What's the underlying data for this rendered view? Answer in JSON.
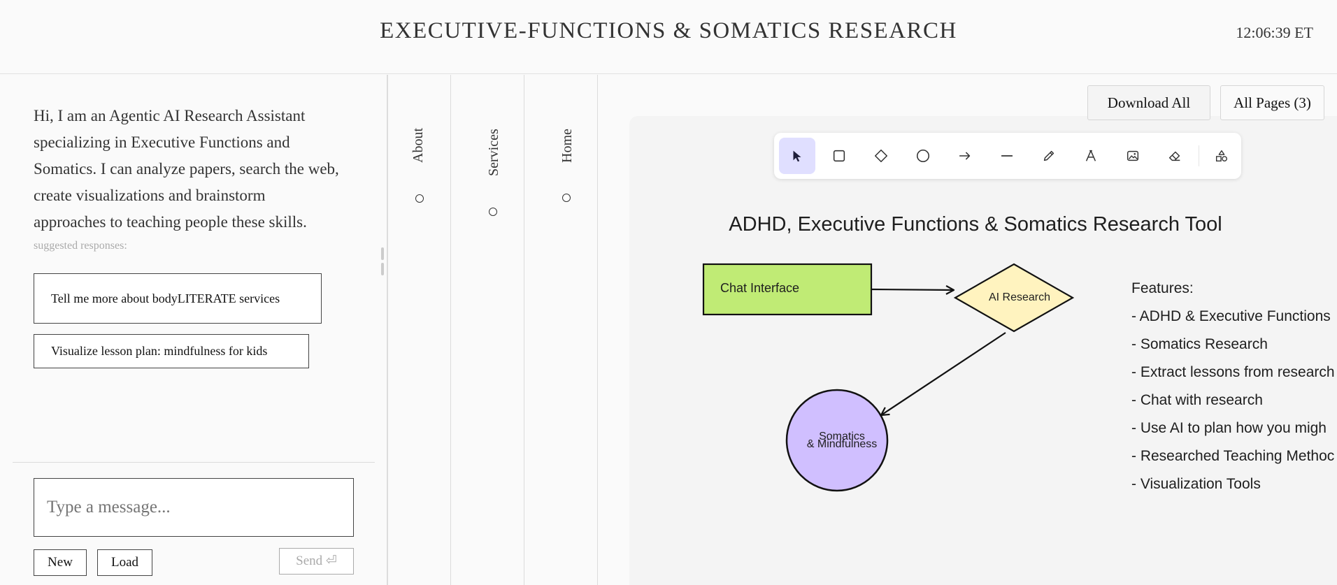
{
  "header": {
    "title": "EXECUTIVE-FUNCTIONS & SOMATICS RESEARCH",
    "clock": "12:06:39 ET"
  },
  "chat": {
    "intro": "Hi, I am an Agentic AI Research Assistant specializing in Executive Functions and Somatics. I can analyze papers, search the web, create visualizations and brainstorm approaches to teaching people these skills.",
    "suggested_label": "suggested responses:",
    "suggestions": [
      "Tell me more about bodyLITERATE services",
      "Visualize lesson plan: mindfulness for kids"
    ],
    "input_placeholder": "Type a message...",
    "new_label": "New",
    "load_label": "Load",
    "send_label": "Send ⏎"
  },
  "nav": {
    "items": [
      "About",
      "Services",
      "Home"
    ]
  },
  "actions": {
    "download_all": "Download All",
    "all_pages": "All Pages (3)"
  },
  "toolbar": {
    "tools": [
      "selection-icon",
      "rectangle-icon",
      "diamond-icon",
      "ellipse-icon",
      "arrow-icon",
      "line-icon",
      "pencil-icon",
      "text-icon",
      "image-icon",
      "eraser-icon",
      "more-shapes-icon"
    ],
    "active": "selection-icon",
    "accent": "#e0dfff"
  },
  "diagram": {
    "title": "ADHD, Executive Functions & Somatics Research Tool",
    "nodes": {
      "chat": {
        "label": "Chat Interface",
        "fill": "#c0eb75"
      },
      "ai": {
        "label": "AI Research",
        "fill": "#fff3bf"
      },
      "somatics": {
        "label_line1": "Somatics",
        "label_line2": "& Mindfulness",
        "fill": "#d0bfff"
      }
    },
    "features": {
      "heading": "Features:",
      "items": [
        "- ADHD & Executive Functions",
        "- Somatics Research",
        "- Extract lessons from research",
        "- Chat with research",
        "- Use AI to plan how you migh",
        "- Researched Teaching Methoc",
        "- Visualization Tools"
      ]
    }
  }
}
